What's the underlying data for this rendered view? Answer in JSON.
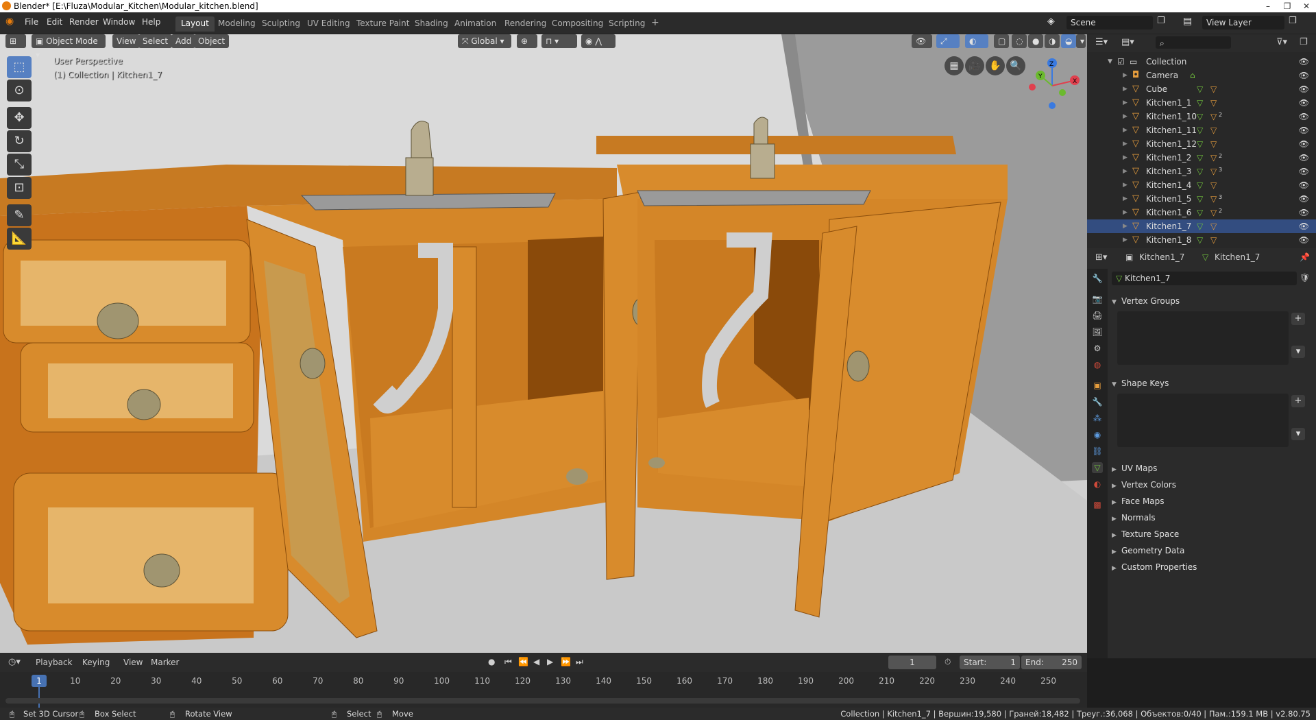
{
  "window": {
    "title": "Blender* [E:\\Fluza\\Modular_Kitchen\\Modular_kitchen.blend]"
  },
  "menu": {
    "items": [
      "File",
      "Edit",
      "Render",
      "Window",
      "Help"
    ]
  },
  "workspaces": [
    "Layout",
    "Modeling",
    "Sculpting",
    "UV Editing",
    "Texture Paint",
    "Shading",
    "Animation",
    "Rendering",
    "Compositing",
    "Scripting"
  ],
  "workspace_active": "Layout",
  "scene": {
    "name": "Scene",
    "view_layer": "View Layer"
  },
  "viewport_header": {
    "mode": "Object Mode",
    "menus": [
      "View",
      "Select",
      "Add",
      "Object"
    ],
    "orientation": "Global"
  },
  "viewport": {
    "perspective_label": "User Perspective",
    "context_label": "(1) Collection | Kitchen1_7",
    "gizmo": {
      "x": "X",
      "y": "Y",
      "z": "Z"
    },
    "colors": {
      "wood": "#d9892a",
      "wood_dark": "#a85f14",
      "wall": "#d8d8d8",
      "floor": "#cfcfcf",
      "metal": "#b8ad8f"
    }
  },
  "outliner": {
    "root": "Collection",
    "items": [
      {
        "name": "Camera",
        "icon": "camera-icon",
        "extra": ""
      },
      {
        "name": "Cube",
        "icon": "mesh-icon",
        "extra": ""
      },
      {
        "name": "Kitchen1_1",
        "icon": "mesh-icon",
        "extra": ""
      },
      {
        "name": "Kitchen1_10",
        "icon": "mesh-icon",
        "extra": "2"
      },
      {
        "name": "Kitchen1_11",
        "icon": "mesh-icon",
        "extra": ""
      },
      {
        "name": "Kitchen1_12",
        "icon": "mesh-icon",
        "extra": ""
      },
      {
        "name": "Kitchen1_2",
        "icon": "mesh-icon",
        "extra": "2"
      },
      {
        "name": "Kitchen1_3",
        "icon": "mesh-icon",
        "extra": "3"
      },
      {
        "name": "Kitchen1_4",
        "icon": "mesh-icon",
        "extra": ""
      },
      {
        "name": "Kitchen1_5",
        "icon": "mesh-icon",
        "extra": "3"
      },
      {
        "name": "Kitchen1_6",
        "icon": "mesh-icon",
        "extra": "2"
      },
      {
        "name": "Kitchen1_7",
        "icon": "mesh-icon",
        "extra": ""
      },
      {
        "name": "Kitchen1_8",
        "icon": "mesh-icon",
        "extra": ""
      }
    ],
    "selected": "Kitchen1_7"
  },
  "properties": {
    "breadcrumb_object": "Kitchen1_7",
    "breadcrumb_data": "Kitchen1_7",
    "data_name": "Kitchen1_7",
    "panels_open": [
      "Vertex Groups",
      "Shape Keys"
    ],
    "panels_closed": [
      "UV Maps",
      "Vertex Colors",
      "Face Maps",
      "Normals",
      "Texture Space",
      "Geometry Data",
      "Custom Properties"
    ]
  },
  "timeline": {
    "menus": [
      "Playback",
      "Keying",
      "View",
      "Marker"
    ],
    "current_frame": "1",
    "start_label": "Start:",
    "start": "1",
    "end_label": "End:",
    "end": "250",
    "ticks": [
      "1",
      "10",
      "20",
      "30",
      "40",
      "50",
      "60",
      "70",
      "80",
      "90",
      "100",
      "110",
      "120",
      "130",
      "140",
      "150",
      "160",
      "170",
      "180",
      "190",
      "200",
      "210",
      "220",
      "230",
      "240",
      "250"
    ]
  },
  "statusbar": {
    "set_cursor": "Set 3D Cursor",
    "box_select": "Box Select",
    "rotate_view": "Rotate View",
    "select": "Select",
    "move": "Move",
    "stats": "Collection | Kitchen1_7 | Вершин:19,580 | Граней:18,482 | Треуг.:36,068 | Объектов:0/40 | Пам.:159.1 MB | v2.80.75"
  }
}
